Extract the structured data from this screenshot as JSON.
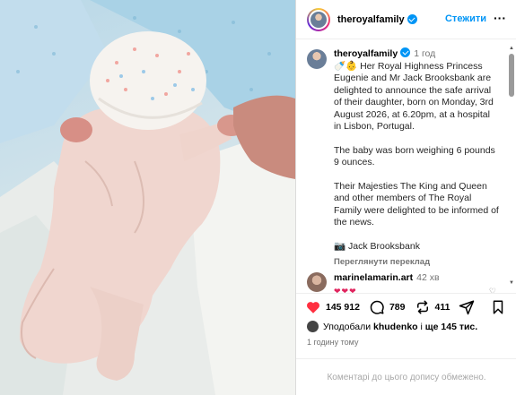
{
  "header": {
    "username": "theroyalfamily",
    "follow_label": "Стежити",
    "more_label": "···"
  },
  "caption": {
    "username": "theroyalfamily",
    "time": "1 год",
    "emojis": "🍼👶",
    "paragraphs": [
      "Her Royal Highness Princess Eugenie and Mr Jack Brooksbank are delighted to announce the safe arrival of their daughter, born on Monday, 3rd August 2026, at 6.20pm, at a hospital in Lisbon, Portugal.",
      "The baby was born weighing 6 pounds 9 ounces.",
      "Their Majesties The King and Queen and other members of The Royal Family were delighted to be informed of the news."
    ],
    "credit": "📷 Jack Brooksbank",
    "translate_label": "Переглянути переклад"
  },
  "comment": {
    "username": "marinelamarin.art",
    "time": "42 хв",
    "text": "❤❤❤"
  },
  "actions": {
    "likes": "145 912",
    "comments": "789",
    "reposts": "411"
  },
  "likes_summary": {
    "prefix": "Уподобали",
    "user": "khudenko",
    "middle": "і",
    "others": "ще 145 тис."
  },
  "posted_time": "1 годину тому",
  "comments_disabled": "Коментарі до цього допису обмежено.",
  "colors": {
    "accent": "#0095f6",
    "like": "#ff3040",
    "muted": "#737373"
  },
  "icons": [
    "verified-badge-icon",
    "heart-icon",
    "comment-icon",
    "repost-icon",
    "share-icon",
    "bookmark-icon",
    "more-icon",
    "camera-icon"
  ]
}
